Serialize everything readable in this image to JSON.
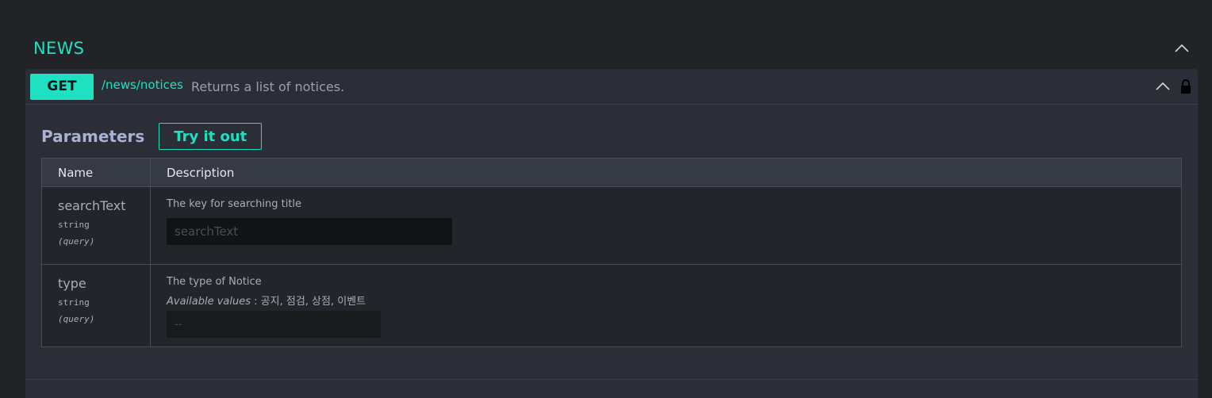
{
  "tag": {
    "title": "NEWS"
  },
  "operation": {
    "method": "GET",
    "path": "/news/notices",
    "summary": "Returns a list of notices."
  },
  "parameters": {
    "title": "Parameters",
    "try_label": "Try it out",
    "columns": {
      "name": "Name",
      "description": "Description"
    },
    "rows": [
      {
        "name": "searchText",
        "type": "string",
        "in": "(query)",
        "description": "The key for searching title",
        "placeholder": "searchText"
      },
      {
        "name": "type",
        "type": "string",
        "in": "(query)",
        "description": "The type of Notice",
        "available_label": "Available values",
        "available_values": ": 공지, 점검, 상점, 이벤트",
        "selected": "--"
      }
    ]
  },
  "colors": {
    "accent": "#1fe0c0",
    "background": "#222327",
    "panel": "#2b2e36"
  },
  "icons": {
    "collapse": "chevron-up-icon",
    "lock": "lock-icon"
  }
}
